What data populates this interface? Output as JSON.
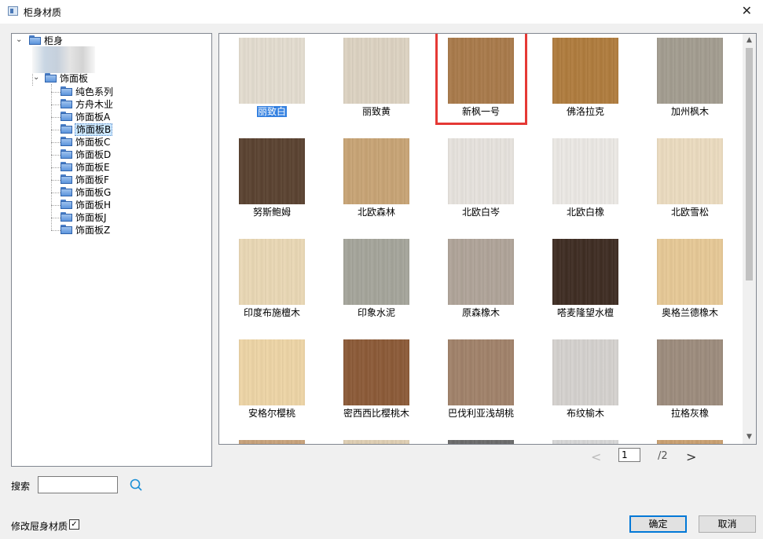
{
  "window": {
    "title": "柜身材质",
    "close_glyph": "✕"
  },
  "tree": {
    "root": "柜身",
    "group": "饰面板",
    "items": [
      "纯色系列",
      "方舟木业",
      "饰面板A",
      "饰面板B",
      "饰面板C",
      "饰面板D",
      "饰面板E",
      "饰面板F",
      "饰面板G",
      "饰面板H",
      "饰面板J",
      "饰面板Z"
    ],
    "selected_index": 3,
    "expanded_glyph": "⌄"
  },
  "materials": [
    {
      "label": "丽致白",
      "color": "#e4ddd0",
      "selected": true
    },
    {
      "label": "丽致黄",
      "color": "#ddd3c2"
    },
    {
      "label": "新枫一号",
      "color": "#a97a4a",
      "highlighted": true
    },
    {
      "label": "佛洛拉克",
      "color": "#b07c3d"
    },
    {
      "label": "加州枫木",
      "color": "#a39d90"
    },
    {
      "label": "努斯鲍姆",
      "color": "#5a4230"
    },
    {
      "label": "北欧森林",
      "color": "#c8a475"
    },
    {
      "label": "北欧白岑",
      "color": "#e7e3de"
    },
    {
      "label": "北欧白橡",
      "color": "#ece9e5"
    },
    {
      "label": "北欧雪松",
      "color": "#ecdcc0"
    },
    {
      "label": "印度布施檀木",
      "color": "#ead8b5"
    },
    {
      "label": "印象水泥",
      "color": "#a5a59b"
    },
    {
      "label": "原森橡木",
      "color": "#b0a499"
    },
    {
      "label": "嗒麦隆望水檀",
      "color": "#3e2c22"
    },
    {
      "label": "奥格兰德橡木",
      "color": "#e7c996"
    },
    {
      "label": "安格尔樱桃",
      "color": "#eed5a6"
    },
    {
      "label": "密西西比樱桃木",
      "color": "#8c5a37"
    },
    {
      "label": "巴伐利亚浅胡桃",
      "color": "#a1826a"
    },
    {
      "label": "布纹榆木",
      "color": "#d5d2cf"
    },
    {
      "label": "拉格灰橡",
      "color": "#9d8c7d"
    },
    {
      "label": "",
      "color": "#c8a27a"
    },
    {
      "label": "",
      "color": "#e0cfb3"
    },
    {
      "label": "",
      "color": "#6a6a6a"
    },
    {
      "label": "",
      "color": "#d8d8d8"
    },
    {
      "label": "",
      "color": "#caa070"
    }
  ],
  "pager": {
    "prev": "<",
    "current_page": "1",
    "total": "/2",
    "next": ">"
  },
  "search": {
    "label": "搜索",
    "value": ""
  },
  "modify_checkbox": {
    "label": "修改屉身材质",
    "checked": true,
    "check_glyph": "✓"
  },
  "buttons": {
    "ok": "确定",
    "cancel": "取消"
  },
  "colors": {
    "highlight_box": "#e53935",
    "selection": "#3380e0",
    "tree_selection": "#cce8ff",
    "accent": "#0078d7"
  }
}
